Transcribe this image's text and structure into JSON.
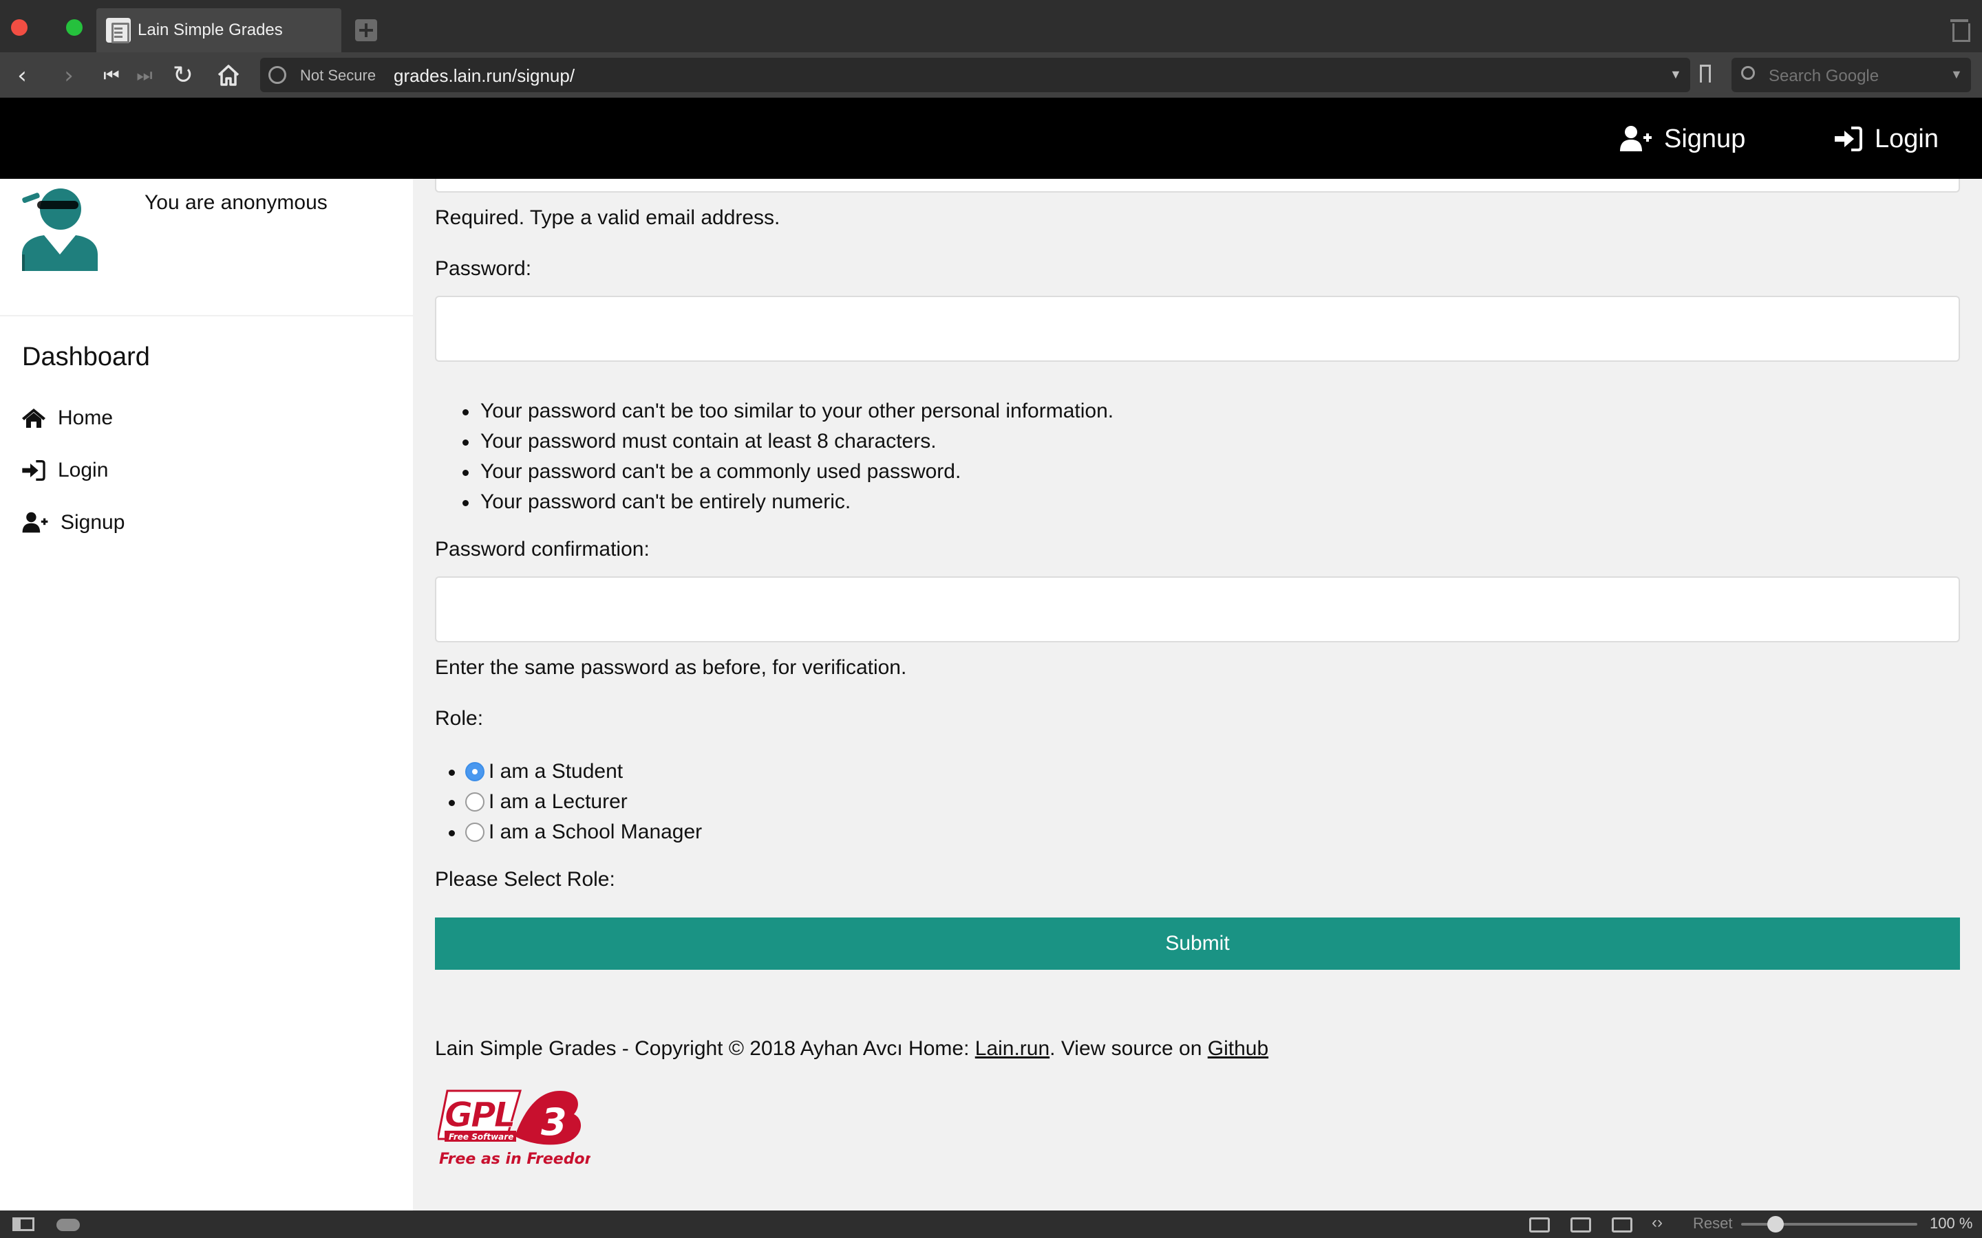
{
  "browser": {
    "tab_title": "Lain Simple Grades",
    "security_label": "Not Secure",
    "url": "grades.lain.run/signup/",
    "search_placeholder": "Search Google"
  },
  "topnav": {
    "signup_label": "Signup",
    "login_label": "Login"
  },
  "sidebar": {
    "user_status": "You are anonymous",
    "dashboard_title": "Dashboard",
    "items": [
      {
        "label": "Home",
        "icon": "home-icon"
      },
      {
        "label": "Login",
        "icon": "sign-in-icon"
      },
      {
        "label": "Signup",
        "icon": "user-plus-icon"
      }
    ]
  },
  "form": {
    "email_help": "Required. Type a valid email address.",
    "password_label": "Password:",
    "password_rules": [
      "Your password can't be too similar to your other personal information.",
      "Your password must contain at least 8 characters.",
      "Your password can't be a commonly used password.",
      "Your password can't be entirely numeric."
    ],
    "password_confirm_label": "Password confirmation:",
    "password_confirm_help": "Enter the same password as before, for verification.",
    "role_label": "Role:",
    "roles": [
      {
        "label": "I am a Student",
        "checked": true
      },
      {
        "label": "I am a Lecturer",
        "checked": false
      },
      {
        "label": "I am a School Manager",
        "checked": false
      }
    ],
    "select_role_label": "Please Select Role:",
    "submit_label": "Submit"
  },
  "footer": {
    "text_before": "Lain Simple Grades - Copyright © 2018 Ayhan Avcı Home: ",
    "home_link": "Lain.run",
    "text_middle": ". View source on ",
    "source_link": "Github",
    "gpl_logo_text": "GPL",
    "gpl_free_software": "Free Software",
    "gpl_slogan": "Free as in Freedom"
  },
  "statusbar": {
    "reset_label": "Reset",
    "zoom_level": "100 %"
  },
  "colors": {
    "accent": "#1a9384",
    "avatar": "#1f7f7d",
    "radio_checked": "#4a98ef",
    "gpl_red": "#c8102e"
  }
}
